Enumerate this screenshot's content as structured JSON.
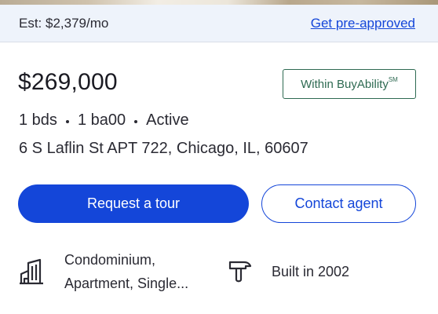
{
  "header": {
    "estimate": "Est: $2,379/mo",
    "preapproved_link": "Get pre-approved"
  },
  "listing": {
    "price": "$269,000",
    "badge_text": "Within BuyAbility",
    "badge_mark": "SM",
    "beds": "1 bds",
    "baths": "1 ba00",
    "status": "Active",
    "address": "6 S Laflin St APT 722, Chicago, IL, 60607"
  },
  "actions": {
    "tour_label": "Request a tour",
    "contact_label": "Contact agent"
  },
  "details": [
    {
      "icon": "building-icon",
      "line1": "Condominium,",
      "line2": "Apartment, Single..."
    },
    {
      "icon": "hammer-icon",
      "text": "Built in 2002"
    }
  ],
  "colors": {
    "accent": "#1446d9",
    "badge": "#2e6a52",
    "header_bg": "#eef3fb"
  }
}
